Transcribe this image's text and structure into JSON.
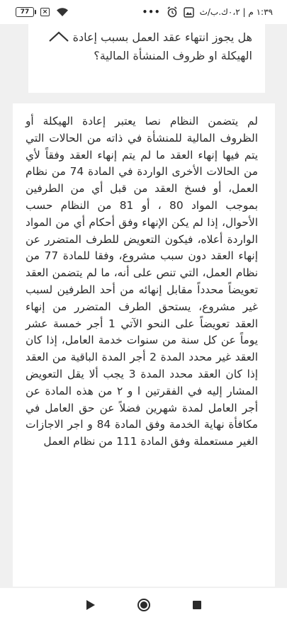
{
  "status_bar": {
    "time": "١:٣٩ م | ٠،٢ك.ب/ث",
    "battery": "77",
    "more_dots": "•••"
  },
  "question": {
    "text": "هل يجوز انتهاء عقد العمل بسبب إعادة الهيكلة او ظروف المنشأة المالية؟"
  },
  "answer": {
    "text": "لم يتضمن النظام نصا يعتبر إعادة الهيكلة أو الظروف المالية للمنشأة في ذاته من الحالات التي يتم فيها إنهاء العقد ما لم يتم إنهاء العقد وفقاً لأي من الحالات الأخرى الواردة في المادة 74 من نظام العمل، أو فسخ العقد من قبل أي من الطرفين بموجب المواد 80 ، أو 81 من النظام حسب الأحوال، إذا لم يكن الإنهاء وفق أحكام أي من المواد الواردة أعلاه، فيكون التعويض للطرف المتضرر عن إنهاء العقد دون سبب مشروع، وفقا للمادة 77 من نظام العمل، التي تنص على أنه، ما لم يتضمن العقد تعويضاً محدداً مقابل إنهائه من أحد الطرفين لسبب غير مشروع، يستحق الطرف المتضرر من إنهاء العقد تعويضاً على النحو الآتي 1 أجر خمسة عشر يوماً عن كل سنة من سنوات خدمة العامل، إذا كان العقد غير محدد المدة 2 أجر المدة الباقية من العقد إذا كان العقد محدد المدة 3 يجب ألا يقل التعويض المشار إليه في الفقرتين ا و ٢ من هذه المادة عن أجر العامل لمدة شهرين فضلاً عن حق العامل في مكافأة نهاية الخدمة وفق المادة 84 و اجر الاجازات الغير مستعملة وفق المادة 111 من نظام العمل"
  },
  "nav": {
    "back": "back-triangle",
    "home": "home-circle",
    "recents": "recents-square"
  }
}
